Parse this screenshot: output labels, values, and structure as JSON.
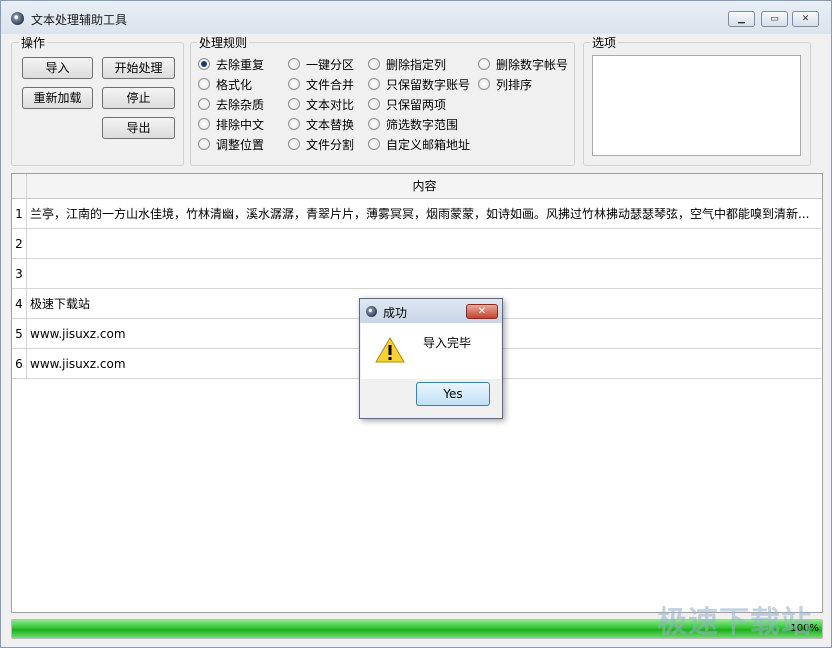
{
  "window": {
    "title": "文本处理辅助工具"
  },
  "actions": {
    "group_title": "操作",
    "import_label": "导入",
    "start_label": "开始处理",
    "reload_label": "重新加载",
    "stop_label": "停止",
    "export_label": "导出"
  },
  "rules": {
    "group_title": "处理规则",
    "items": [
      {
        "label": "去除重复",
        "checked": true
      },
      {
        "label": "格式化",
        "checked": false
      },
      {
        "label": "去除杂质",
        "checked": false
      },
      {
        "label": "排除中文",
        "checked": false
      },
      {
        "label": "调整位置",
        "checked": false
      },
      {
        "label": "一键分区",
        "checked": false
      },
      {
        "label": "文件合并",
        "checked": false
      },
      {
        "label": "文本对比",
        "checked": false
      },
      {
        "label": "文本替换",
        "checked": false
      },
      {
        "label": "文件分割",
        "checked": false
      },
      {
        "label": "删除指定列",
        "checked": false
      },
      {
        "label": "只保留数字账号",
        "checked": false
      },
      {
        "label": "只保留两项",
        "checked": false
      },
      {
        "label": "筛选数字范围",
        "checked": false
      },
      {
        "label": "自定义邮箱地址",
        "checked": false
      },
      {
        "label": "删除数字帐号",
        "checked": false
      },
      {
        "label": "列排序",
        "checked": false
      }
    ]
  },
  "options": {
    "group_title": "选项"
  },
  "grid": {
    "column_header": "内容",
    "rows": [
      {
        "num": "1",
        "content": "兰亭，江南的一方山水佳境，竹林清幽，溪水潺潺，青翠片片，薄雾冥冥，烟雨蒙蒙，如诗如画。风拂过竹林拂动瑟瑟琴弦，空气中都能嗅到清新..."
      },
      {
        "num": "2",
        "content": ""
      },
      {
        "num": "3",
        "content": ""
      },
      {
        "num": "4",
        "content": "极速下载站"
      },
      {
        "num": "5",
        "content": "www.jisuxz.com"
      },
      {
        "num": "6",
        "content": "www.jisuxz.com"
      }
    ]
  },
  "progress": {
    "value": 1.0,
    "text": "100%"
  },
  "watermark": "极速下载站",
  "dialog": {
    "title": "成功",
    "message": "导入完毕",
    "yes_label": "Yes",
    "icon": "warning-icon"
  },
  "colors": {
    "progress_fill": "#2fc42f",
    "radio_dot": "#1b3b6b",
    "close_red": "#c7432f"
  }
}
